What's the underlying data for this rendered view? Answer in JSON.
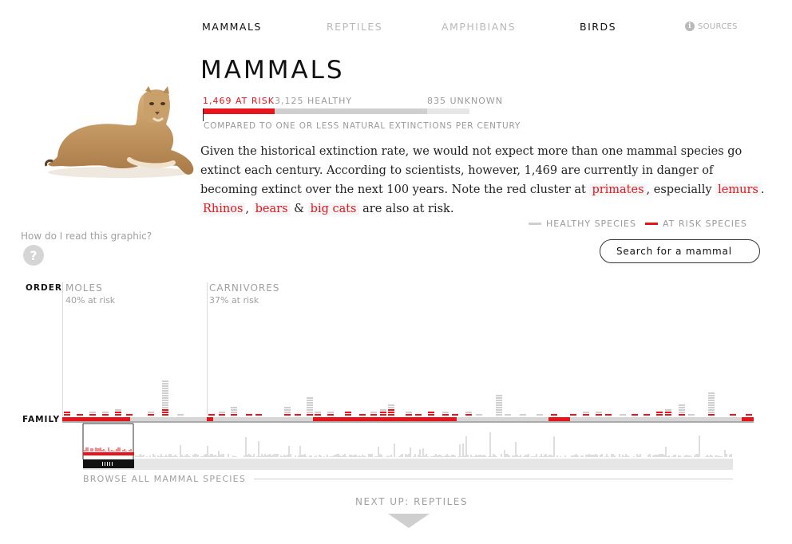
{
  "nav": {
    "tabs": [
      {
        "label": "MAMMALS",
        "active": true
      },
      {
        "label": "REPTILES",
        "active": false
      },
      {
        "label": "AMPHIBIANS",
        "active": false
      },
      {
        "label": "BIRDS",
        "active": true
      }
    ],
    "sources_label": "SOURCES",
    "info_glyph": "i"
  },
  "header": {
    "title": "MAMMALS"
  },
  "stats": {
    "at_risk": "1,469 AT RISK",
    "healthy": "3,125 HEALTHY",
    "unknown": "835 UNKNOWN",
    "compared": "COMPARED TO ONE OR LESS NATURAL EXTINCTIONS PER CENTURY"
  },
  "intro": {
    "text1": "Given the historical extinction rate, we would not expect more than one mammal species go extinct each century. According to scientists, however, 1,469 are currently in danger of becoming extinct over the next 100 years. Note the red cluster at ",
    "link_primates": "primates",
    "text2": ", especially ",
    "link_lemurs": "lemurs",
    "text3": ". ",
    "link_rhinos": "Rhinos",
    "text4": ", ",
    "link_bears": "bears",
    "text5": " & ",
    "link_bigcats": "big cats",
    "text6": " are also at risk."
  },
  "legend": {
    "healthy": "HEALTHY SPECIES",
    "at_risk": "AT RISK SPECIES"
  },
  "help": {
    "question": "How do I read this graphic?",
    "glyph": "?"
  },
  "search": {
    "placeholder": "Search for a mammal",
    "value": ""
  },
  "chart": {
    "order_label": "ORDER",
    "family_label": "FAMILY",
    "orders": [
      {
        "name": "MOLES",
        "pct": "40% at risk"
      },
      {
        "name": "CARNIVORES",
        "pct": "37% at risk"
      }
    ]
  },
  "browse": {
    "label": "BROWSE ALL MAMMAL SPECIES",
    "handle_glyph": "|||||"
  },
  "next": {
    "label": "NEXT UP: REPTILES"
  },
  "colors": {
    "risk": "#e8141c",
    "healthy": "#cfcfcf",
    "text": "#111111",
    "muted": "#a0a0a0"
  }
}
